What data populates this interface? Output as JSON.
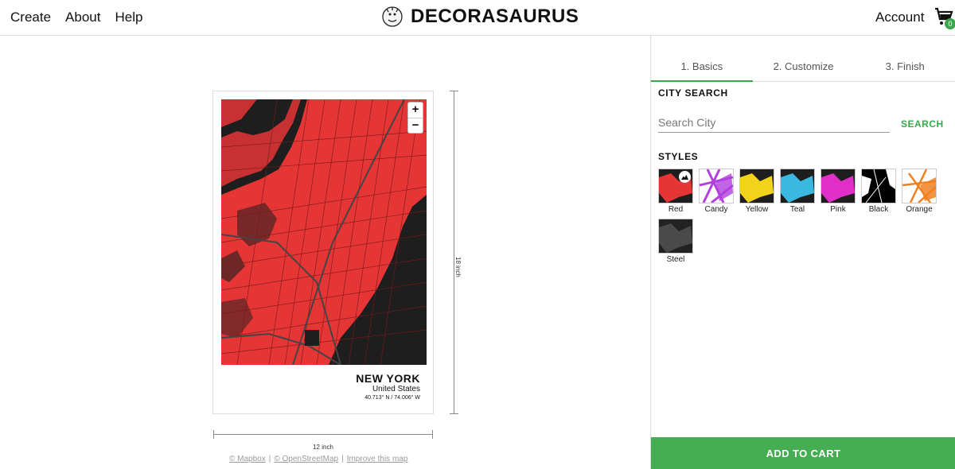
{
  "nav": {
    "create": "Create",
    "about": "About",
    "help": "Help"
  },
  "logo": {
    "text": "DECORASAURUS",
    "icon": "dinosaur-logo-icon"
  },
  "account": {
    "label": "Account",
    "cart_count": "0",
    "cart_icon": "shopping-cart-icon"
  },
  "poster": {
    "city": "NEW YORK",
    "country": "United States",
    "coords": "40.713° N / 74.006° W",
    "zoom_in": "+",
    "zoom_out": "−",
    "height_label": "18 inch",
    "width_label": "12 inch"
  },
  "attribution": {
    "mapbox": "© Mapbox",
    "osm": "© OpenStreetMap",
    "improve": "Improve this map"
  },
  "tabs": [
    {
      "label": "1. Basics",
      "active": true
    },
    {
      "label": "2. Customize",
      "active": false
    },
    {
      "label": "3. Finish",
      "active": false
    }
  ],
  "city_search": {
    "title": "CITY SEARCH",
    "placeholder": "Search City",
    "value": "",
    "button": "SEARCH"
  },
  "styles": {
    "title": "STYLES",
    "items": [
      {
        "label": "Red",
        "selected": true
      },
      {
        "label": "Candy",
        "selected": false
      },
      {
        "label": "Yellow",
        "selected": false
      },
      {
        "label": "Teal",
        "selected": false
      },
      {
        "label": "Pink",
        "selected": false
      },
      {
        "label": "Black",
        "selected": false
      },
      {
        "label": "Orange",
        "selected": false
      },
      {
        "label": "Steel",
        "selected": false
      }
    ]
  },
  "add_to_cart": "ADD TO CART",
  "colors": {
    "accent": "#45ad52",
    "map_red": "#e63535",
    "map_dark": "#1e1e1e"
  }
}
